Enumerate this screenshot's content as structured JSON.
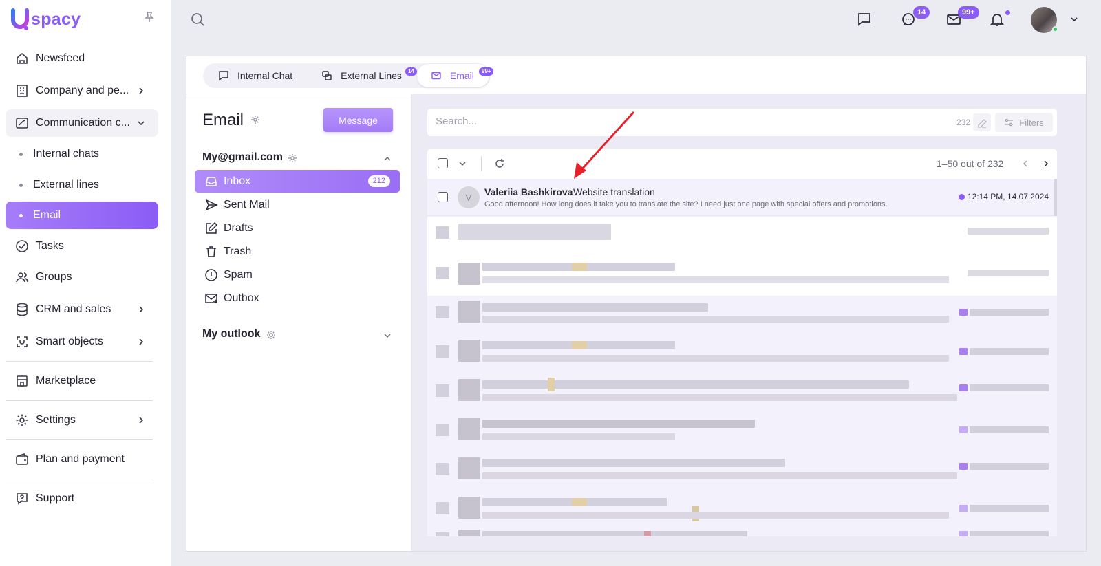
{
  "app": {
    "logo_text": "spacy"
  },
  "sidebar": {
    "items": [
      {
        "label": "Newsfeed"
      },
      {
        "label": "Company and pe..."
      },
      {
        "label": "Communication c..."
      },
      {
        "label": "Internal chats"
      },
      {
        "label": "External lines"
      },
      {
        "label": "Email"
      },
      {
        "label": "Tasks"
      },
      {
        "label": "Groups"
      },
      {
        "label": "CRM and sales"
      },
      {
        "label": "Smart objects"
      },
      {
        "label": "Marketplace"
      },
      {
        "label": "Settings"
      },
      {
        "label": "Plan and payment"
      },
      {
        "label": "Support"
      }
    ]
  },
  "topbar": {
    "chats_badge": "14",
    "mail_badge": "99+"
  },
  "tabs": [
    {
      "label": "Internal Chat",
      "badge": ""
    },
    {
      "label": "External Lines",
      "badge": "14"
    },
    {
      "label": "Email",
      "badge": "99+"
    }
  ],
  "folders": {
    "title": "Email",
    "message_button": "Message",
    "account1": "My@gmail.com",
    "account2": "My outlook",
    "items": [
      {
        "label": "Inbox",
        "count": "212"
      },
      {
        "label": "Sent Mail"
      },
      {
        "label": "Drafts"
      },
      {
        "label": "Trash"
      },
      {
        "label": "Spam"
      },
      {
        "label": "Outbox"
      }
    ]
  },
  "search": {
    "placeholder": "Search...",
    "count": "232",
    "filters_label": "Filters"
  },
  "list": {
    "page_info": "1–50 out of 232",
    "email": {
      "avatar_letter": "V",
      "sender": "Valeriia Bashkirova",
      "subject": "Website translation",
      "preview": "Good afternoon! How long does it take you to translate the site? I need  just one page with special offers and promotions.",
      "time": "12:14 PM, 14.07.2024"
    }
  },
  "colors": {
    "accent": "#8b5cf6",
    "arrow": "#e8202a"
  }
}
